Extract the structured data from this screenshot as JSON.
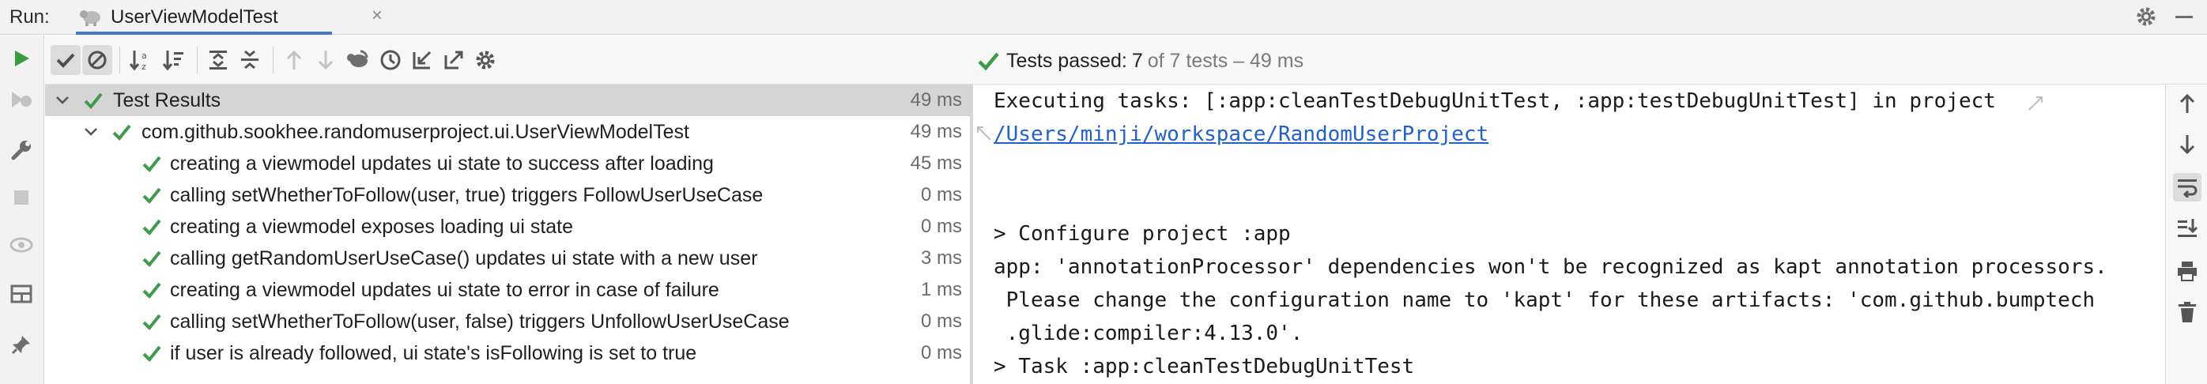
{
  "run_bar": {
    "label": "Run:",
    "tab_title": "UserViewModelTest",
    "tab_close": "×"
  },
  "status": {
    "main": "Tests passed:",
    "count": "7",
    "rest": "of 7 tests – 49 ms"
  },
  "tree": {
    "root": {
      "label": "Test Results",
      "duration": "49 ms"
    },
    "suite": {
      "label": "com.github.sookhee.randomuserproject.ui.UserViewModelTest",
      "duration": "49 ms"
    },
    "tests": [
      {
        "label": "creating a viewmodel updates ui state to success after loading",
        "duration": "45 ms"
      },
      {
        "label": "calling setWhetherToFollow(user, true) triggers FollowUserUseCase",
        "duration": "0 ms"
      },
      {
        "label": "creating a viewmodel exposes loading ui state",
        "duration": "0 ms"
      },
      {
        "label": "calling getRandomUserUseCase() updates ui state with a new user",
        "duration": "3 ms"
      },
      {
        "label": "creating a viewmodel updates ui state to error in case of failure",
        "duration": "1 ms"
      },
      {
        "label": "calling setWhetherToFollow(user, false) triggers UnfollowUserUseCase",
        "duration": "0 ms"
      },
      {
        "label": "if user is already followed, ui state's isFollowing is set to true",
        "duration": "0 ms"
      }
    ]
  },
  "console": {
    "line1": "Executing tasks: [:app:cleanTestDebugUnitTest, :app:testDebugUnitTest] in project",
    "line2_link": "/Users/minji/workspace/RandomUserProject",
    "line3": "> Configure project :app",
    "line4": "app: 'annotationProcessor' dependencies won't be recognized as kapt annotation processors.",
    "line5": " Please change the configuration name to 'kapt' for these artifacts: 'com.github.bumptech",
    "line6": " .glide:compiler:4.13.0'.",
    "line7": "> Task :app:cleanTestDebugUnitTest"
  },
  "colors": {
    "pass_green": "#3f9a4a",
    "link_blue": "#2261c9",
    "tab_underline": "#4a78c2",
    "run_green": "#3c9a43"
  }
}
